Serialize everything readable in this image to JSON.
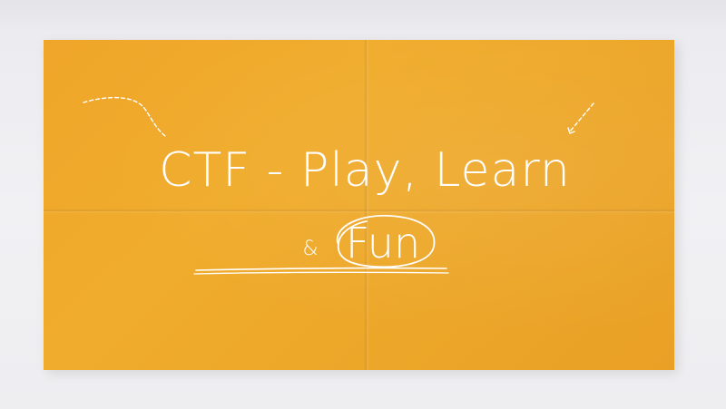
{
  "slide": {
    "title_line1": "CTF - Play, Learn",
    "title_line2_prefix": "&",
    "title_line2_highlight": "Fun"
  },
  "colors": {
    "paper": "#f0ab2c",
    "ink": "#ffffff",
    "background": "#eeeef1"
  },
  "icons": {
    "left_flourish": "dashed-curve-arrow-icon",
    "right_flourish": "dashed-arrow-icon",
    "circle": "hand-drawn-circle-icon",
    "underline": "hand-drawn-underline-icon"
  }
}
